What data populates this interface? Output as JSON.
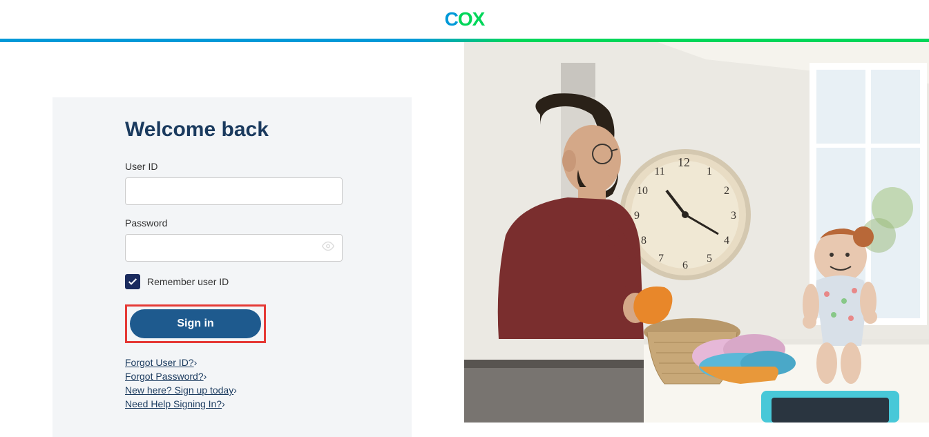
{
  "header": {
    "logo_text": "COX"
  },
  "login": {
    "title": "Welcome back",
    "user_id_label": "User ID",
    "user_id_value": "",
    "password_label": "Password",
    "password_value": "",
    "remember_label": "Remember user ID",
    "remember_checked": true,
    "signin_button": "Sign in",
    "links": {
      "forgot_user_id": "Forgot User ID?",
      "forgot_password": "Forgot Password?",
      "sign_up": "New here? Sign up today",
      "need_help": "Need Help Signing In?"
    }
  },
  "colors": {
    "brand_blue": "#0099d8",
    "brand_green": "#00d659",
    "dark_navy": "#1a3a5e",
    "button_blue": "#1e5a8e",
    "highlight_red": "#e53935"
  }
}
